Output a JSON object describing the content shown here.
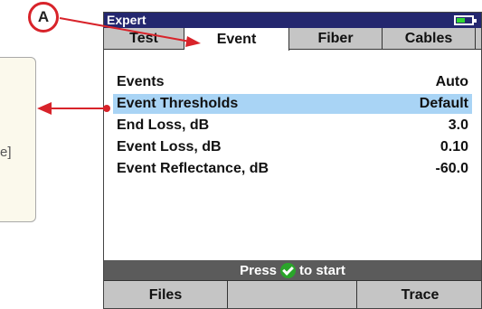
{
  "callout": {
    "fragment_text": "e]",
    "marker_label": "A"
  },
  "device": {
    "title": "Expert",
    "tabs": [
      {
        "label": "Test",
        "active": false
      },
      {
        "label": "Event",
        "active": true
      },
      {
        "label": "Fiber",
        "active": false
      },
      {
        "label": "Cables",
        "active": false
      }
    ],
    "settings": [
      {
        "label": "Events",
        "value": "Auto",
        "selected": false
      },
      {
        "label": "Event Thresholds",
        "value": "Default",
        "selected": true
      },
      {
        "label": "End Loss, dB",
        "value": "3.0",
        "selected": false
      },
      {
        "label": "Event Loss, dB",
        "value": "0.10",
        "selected": false
      },
      {
        "label": "Event Reflectance, dB",
        "value": "-60.0",
        "selected": false
      }
    ],
    "status": {
      "before": "Press",
      "after": "to start",
      "icon": "check-icon"
    },
    "softkeys": [
      {
        "label": "Files"
      },
      {
        "label": ""
      },
      {
        "label": "Trace"
      }
    ],
    "battery": {
      "level": 0.45,
      "color": "#2fd82f"
    },
    "colors": {
      "title_bar": "#24276f",
      "selection": "#a9d4f5",
      "status_bar": "#5b5b5b",
      "annotation": "#d8232a"
    }
  }
}
